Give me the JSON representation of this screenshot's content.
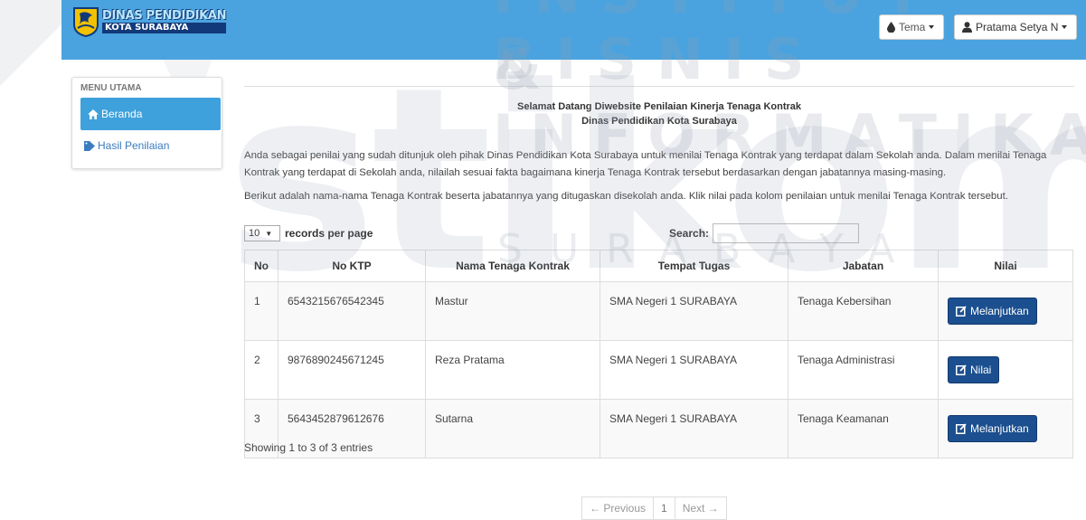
{
  "watermark": {
    "top_text": "INSTITUT BISNIS",
    "mid_text": "& INFORMATIKA",
    "big_text": "stikom",
    "bottom_text": "SURABAYA"
  },
  "header": {
    "logo_line1": "DINAS PENDIDIKAN",
    "logo_line2": "KOTA SURABAYA",
    "theme_label": "Tema",
    "user_label": "Pratama Setya N",
    "bg_color": "#4aa3df"
  },
  "sidebar": {
    "title": "MENU UTAMA",
    "items": [
      {
        "label": "Beranda",
        "icon": "home-icon",
        "active": true
      },
      {
        "label": "Hasil Penilaian",
        "icon": "tag-icon",
        "active": false
      }
    ],
    "active_color": "#3ea1dc"
  },
  "main": {
    "welcome_line1": "Selamat Datang Diwebsite Penilaian Kinerja Tenaga Kontrak",
    "welcome_line2": "Dinas Pendidikan Kota Surabaya",
    "paragraph1": "Anda sebagai penilai yang sudah ditunjuk oleh pihak Dinas Pendidikan Kota Surabaya untuk menilai Tenaga Kontrak yang terdapat dalam Sekolah anda. Dalam menilai Tenaga Kontrak yang terdapat di Sekolah anda, nilailah sesuai fakta bagaimana kinerja Tenaga Kontrak tersebut berdasarkan dengan jabatannya masing-masing.",
    "paragraph2": "Berikut adalah nama-nama Tenaga Kontrak beserta jabatannya yang ditugaskan disekolah anda. Klik nilai pada kolom penilaian untuk menilai Tenaga Kontrak tersebut."
  },
  "table": {
    "records_value": "10",
    "records_label": "records per page",
    "search_label": "Search:",
    "search_value": "",
    "columns": [
      "No",
      "No KTP",
      "Nama Tenaga Kontrak",
      "Tempat Tugas",
      "Jabatan",
      "Nilai"
    ],
    "rows": [
      {
        "no": "1",
        "ktp": "6543215676542345",
        "nama": "Mastur",
        "tempat": "SMA Negeri 1 SURABAYA",
        "jabatan": "Tenaga Kebersihan",
        "action": "Melanjutkan"
      },
      {
        "no": "2",
        "ktp": "9876890245671245",
        "nama": "Reza Pratama",
        "tempat": "SMA Negeri 1 SURABAYA",
        "jabatan": "Tenaga Administrasi",
        "action": "Nilai"
      },
      {
        "no": "3",
        "ktp": "5643452879612676",
        "nama": "Sutarna",
        "tempat": "SMA Negeri 1 SURABAYA",
        "jabatan": "Tenaga Keamanan",
        "action": "Melanjutkan"
      }
    ],
    "action_color": "#1b4f8f",
    "info": "Showing 1 to 3 of 3 entries"
  },
  "pagination": {
    "previous": "← Previous",
    "current": "1",
    "next": "Next →"
  }
}
